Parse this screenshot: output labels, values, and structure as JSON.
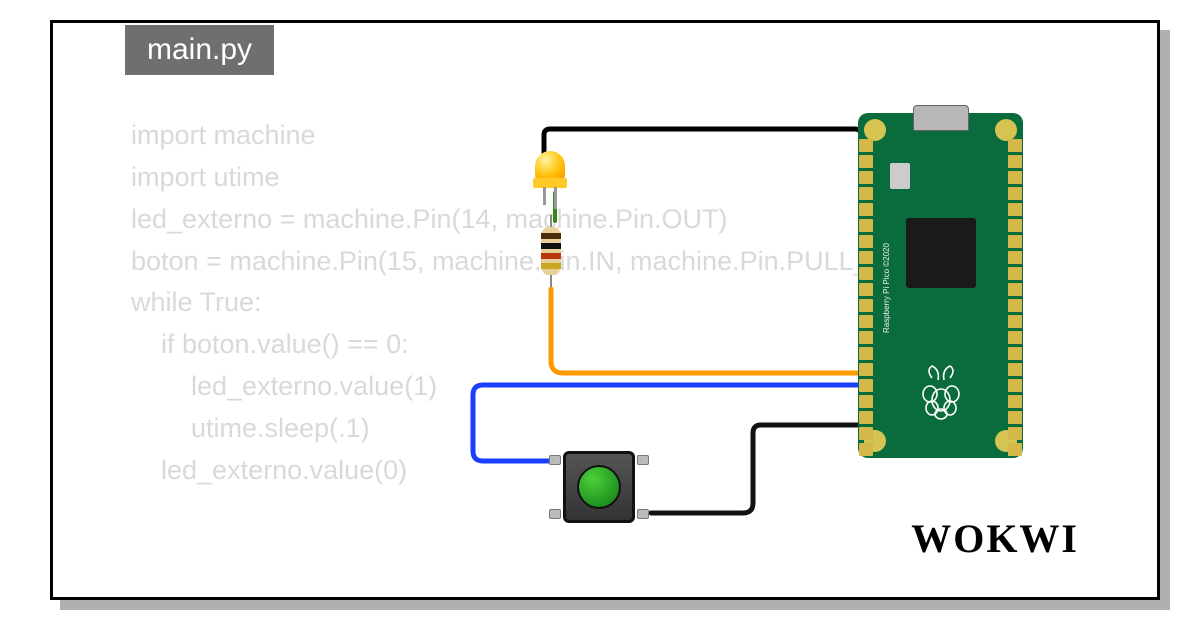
{
  "tab": "main.py",
  "code": "import machine\nimport utime\nled_externo = machine.Pin(14, machine.Pin.OUT)\nboton = machine.Pin(15, machine.Pin.IN, machine.Pin.PULL_UP)\nwhile True:\n    if boton.value() == 0:\n        led_externo.value(1)\n        utime.sleep(.1)\n    led_externo.value(0)",
  "brand": "WOKWI",
  "board": {
    "name": "Raspberry Pi Pico",
    "copyright": "©2020"
  },
  "components": {
    "led": {
      "color": "yellow"
    },
    "resistor": {
      "bands": [
        "brown",
        "black",
        "orange",
        "gold"
      ]
    },
    "button": {
      "cap_color": "green"
    }
  },
  "wires": [
    {
      "color": "#000000",
      "from": "led.anode",
      "to": "pico.gnd_top_left"
    },
    {
      "color": "#2e8b0f",
      "from": "led.cathode",
      "to": "resistor.top"
    },
    {
      "color": "#ff9900",
      "from": "resistor.bottom",
      "to": "pico.gp14"
    },
    {
      "color": "#1a3fff",
      "from": "button.top_left",
      "to": "pico.gp15"
    },
    {
      "color": "#111111",
      "from": "button.bottom_right",
      "to": "pico.gnd_bottom"
    }
  ]
}
